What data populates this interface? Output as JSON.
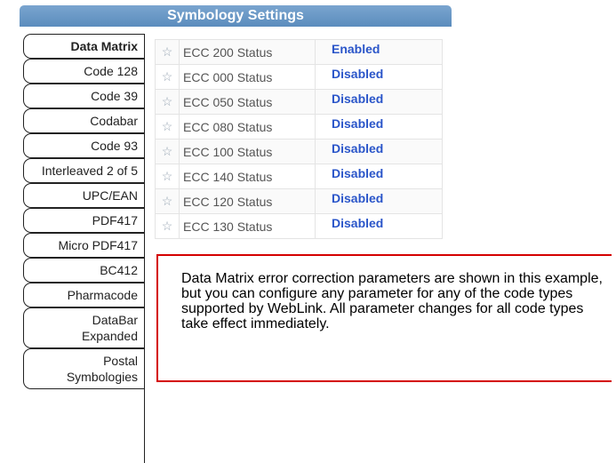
{
  "header": {
    "title": "Symbology Settings"
  },
  "tabs": [
    {
      "label": "Data Matrix",
      "active": true
    },
    {
      "label": "Code 128"
    },
    {
      "label": "Code 39"
    },
    {
      "label": "Codabar"
    },
    {
      "label": "Code 93"
    },
    {
      "label": "Interleaved 2 of 5"
    },
    {
      "label": "UPC/EAN"
    },
    {
      "label": "PDF417"
    },
    {
      "label": "Micro PDF417"
    },
    {
      "label": "BC412"
    },
    {
      "label": "Pharmacode"
    },
    {
      "label_line1": "DataBar",
      "label_line2": "Expanded"
    },
    {
      "label_line1": "Postal",
      "label_line2": "Symbologies"
    }
  ],
  "params": [
    {
      "name": "ECC 200 Status",
      "value": "Enabled"
    },
    {
      "name": "ECC 000 Status",
      "value": "Disabled"
    },
    {
      "name": "ECC 050 Status",
      "value": "Disabled"
    },
    {
      "name": "ECC 080 Status",
      "value": "Disabled"
    },
    {
      "name": "ECC 100 Status",
      "value": "Disabled"
    },
    {
      "name": "ECC 140 Status",
      "value": "Disabled"
    },
    {
      "name": "ECC 120 Status",
      "value": "Disabled"
    },
    {
      "name": "ECC 130 Status",
      "value": "Disabled"
    }
  ],
  "icons": {
    "favorite": "star-outline-icon",
    "star_glyph": "☆"
  },
  "note": {
    "text": "Data Matrix error correction parameters are shown in this example, but you can configure any parameter for any of the code types supported by WebLink. All parameter changes for all code types take effect immediately."
  },
  "colors": {
    "header": "#6a98c6",
    "value": "#2a55c9",
    "callout_border": "#d40000"
  }
}
